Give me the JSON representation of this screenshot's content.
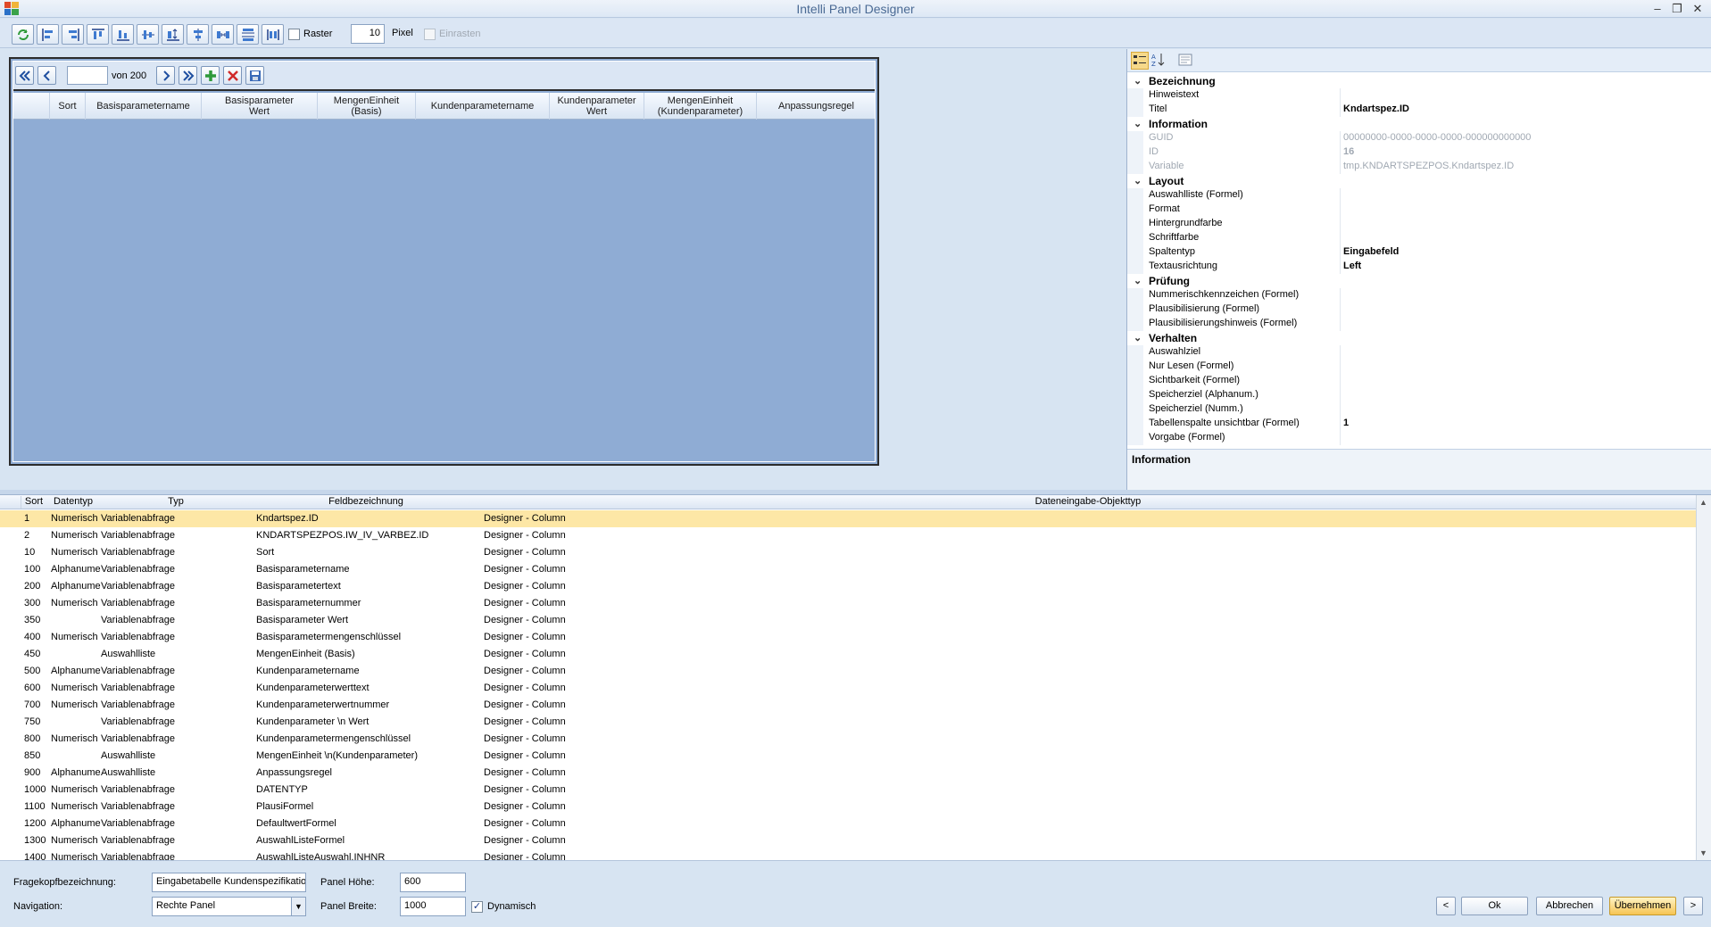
{
  "window": {
    "title": "Intelli Panel Designer",
    "controls": [
      "minimize-icon",
      "restore-icon",
      "close-icon"
    ]
  },
  "toolbar": {
    "buttons": [
      "refresh-icon",
      "align-left-icon",
      "align-right-icon",
      "align-top-icon",
      "align-bottom-icon",
      "align-center-horizontal-icon",
      "same-height-icon",
      "align-middle-icon",
      "distribute-horizontal-icon",
      "distribute-vertical-icon",
      "same-width-icon"
    ],
    "raster_label": "Raster",
    "raster_checked": false,
    "grid_size": "10",
    "pixel_label": "Pixel",
    "snap_label": "Einrasten",
    "snap_checked": false
  },
  "panel_preview": {
    "navigator": {
      "position_value": "",
      "of_label": "von 200"
    },
    "columns": [
      "Sort",
      "Basisparametername",
      "Basisparameter\nWert",
      "MengenEinheit\n(Basis)",
      "Kundenparametername",
      "Kundenparameter\nWert",
      "MengenEinheit\n(Kundenparameter)",
      "Anpassungsregel"
    ]
  },
  "property_grid": {
    "categories": [
      {
        "name": "Bezeichnung",
        "items": [
          {
            "name": "Hinweistext",
            "value": ""
          },
          {
            "name": "Titel",
            "value": "Kndartspez.ID",
            "bold": true
          }
        ]
      },
      {
        "name": "Information",
        "items": [
          {
            "name": "GUID",
            "value": "00000000-0000-0000-0000-000000000000",
            "disabled": true
          },
          {
            "name": "ID",
            "value": "16",
            "disabled": true,
            "bold": true
          },
          {
            "name": "Variable",
            "value": "tmp.KNDARTSPEZPOS.Kndartspez.ID",
            "disabled": true
          }
        ]
      },
      {
        "name": "Layout",
        "items": [
          {
            "name": "Auswahlliste (Formel)",
            "value": ""
          },
          {
            "name": "Format",
            "value": ""
          },
          {
            "name": "Hintergrundfarbe",
            "value": ""
          },
          {
            "name": "Schriftfarbe",
            "value": ""
          },
          {
            "name": "Spaltentyp",
            "value": "Eingabefeld",
            "bold": true
          },
          {
            "name": "Textausrichtung",
            "value": "Left",
            "bold": true
          }
        ]
      },
      {
        "name": "Prüfung",
        "items": [
          {
            "name": "Nummerischkennzeichen (Formel)",
            "value": ""
          },
          {
            "name": "Plausibilisierung (Formel)",
            "value": ""
          },
          {
            "name": "Plausibilisierungshinweis (Formel)",
            "value": ""
          }
        ]
      },
      {
        "name": "Verhalten",
        "items": [
          {
            "name": "Auswahlziel",
            "value": ""
          },
          {
            "name": "Nur Lesen (Formel)",
            "value": ""
          },
          {
            "name": "Sichtbarkeit (Formel)",
            "value": ""
          },
          {
            "name": "Speicherziel (Alphanum.)",
            "value": ""
          },
          {
            "name": "Speicherziel (Numm.)",
            "value": ""
          },
          {
            "name": "Tabellenspalte unsichtbar (Formel)",
            "value": "1",
            "bold": true
          },
          {
            "name": "Vorgabe (Formel)",
            "value": ""
          }
        ]
      }
    ],
    "info_title": "Information"
  },
  "field_list": {
    "headers": [
      "Sort",
      "Datentyp",
      "Typ",
      "Feldbezeichnung",
      "Dateneingabe-Objekttyp"
    ],
    "rows": [
      [
        "1",
        "Numerisch",
        "Variablenabfrage",
        "Kndartspez.ID",
        "Designer - Column"
      ],
      [
        "2",
        "Numerisch",
        "Variablenabfrage",
        "KNDARTSPEZPOS.IW_IV_VARBEZ.ID",
        "Designer - Column"
      ],
      [
        "10",
        "Numerisch",
        "Variablenabfrage",
        "Sort",
        "Designer - Column"
      ],
      [
        "100",
        "Alphanume",
        "Variablenabfrage",
        "Basisparametername",
        "Designer - Column"
      ],
      [
        "200",
        "Alphanume",
        "Variablenabfrage",
        "Basisparametertext",
        "Designer - Column"
      ],
      [
        "300",
        "Numerisch",
        "Variablenabfrage",
        "Basisparameternummer",
        "Designer - Column"
      ],
      [
        "350",
        "",
        "Variablenabfrage",
        "Basisparameter Wert",
        "Designer - Column"
      ],
      [
        "400",
        "Numerisch",
        "Variablenabfrage",
        "Basisparametermengenschlüssel",
        "Designer - Column"
      ],
      [
        "450",
        "",
        "Auswahlliste",
        "MengenEinheit (Basis)",
        "Designer - Column"
      ],
      [
        "500",
        "Alphanume",
        "Variablenabfrage",
        "Kundenparametername",
        "Designer - Column"
      ],
      [
        "600",
        "Numerisch",
        "Variablenabfrage",
        "Kundenparameterwerttext",
        "Designer - Column"
      ],
      [
        "700",
        "Numerisch",
        "Variablenabfrage",
        "Kundenparameterwertnummer",
        "Designer - Column"
      ],
      [
        "750",
        "",
        "Variablenabfrage",
        "Kundenparameter \\n Wert",
        "Designer - Column"
      ],
      [
        "800",
        "Numerisch",
        "Variablenabfrage",
        "Kundenparametermengenschlüssel",
        "Designer - Column"
      ],
      [
        "850",
        "",
        "Auswahlliste",
        "MengenEinheit \\n(Kundenparameter)",
        "Designer - Column"
      ],
      [
        "900",
        "Alphanume",
        "Auswahlliste",
        "Anpassungsregel",
        "Designer - Column"
      ],
      [
        "1000",
        "Numerisch",
        "Variablenabfrage",
        "DATENTYP",
        "Designer - Column"
      ],
      [
        "1100",
        "Numerisch",
        "Variablenabfrage",
        "PlausiFormel",
        "Designer - Column"
      ],
      [
        "1200",
        "Alphanume",
        "Variablenabfrage",
        "DefaultwertFormel",
        "Designer - Column"
      ],
      [
        "1300",
        "Numerisch",
        "Variablenabfrage",
        "AuswahlListeFormel",
        "Designer - Column"
      ],
      [
        "1400",
        "Numerisch",
        "Variablenabfrage",
        "AuswahlListeAuswahl.INHNR",
        "Designer - Column"
      ]
    ],
    "selected_index": 0
  },
  "footer": {
    "question_label": "Fragekopfbezeichnung:",
    "question_value": "Eingabetabelle Kundenspezifikation",
    "navigation_label": "Navigation:",
    "navigation_value": "Rechte Panel",
    "height_label": "Panel Höhe:",
    "height_value": "600",
    "width_label": "Panel Breite:",
    "width_value": "1000",
    "dynamic_label": "Dynamisch",
    "dynamic_checked": true,
    "prev_label": "<",
    "ok_label": "Ok",
    "cancel_label": "Abbrechen",
    "apply_label": "Übernehmen",
    "next_label": ">"
  },
  "colors": {
    "background": "#d7e4f2",
    "panel_fill": "#8facd4",
    "selected_row": "#fde7a6",
    "accent_button": "#f6c453",
    "title_text": "#4a6a94"
  }
}
